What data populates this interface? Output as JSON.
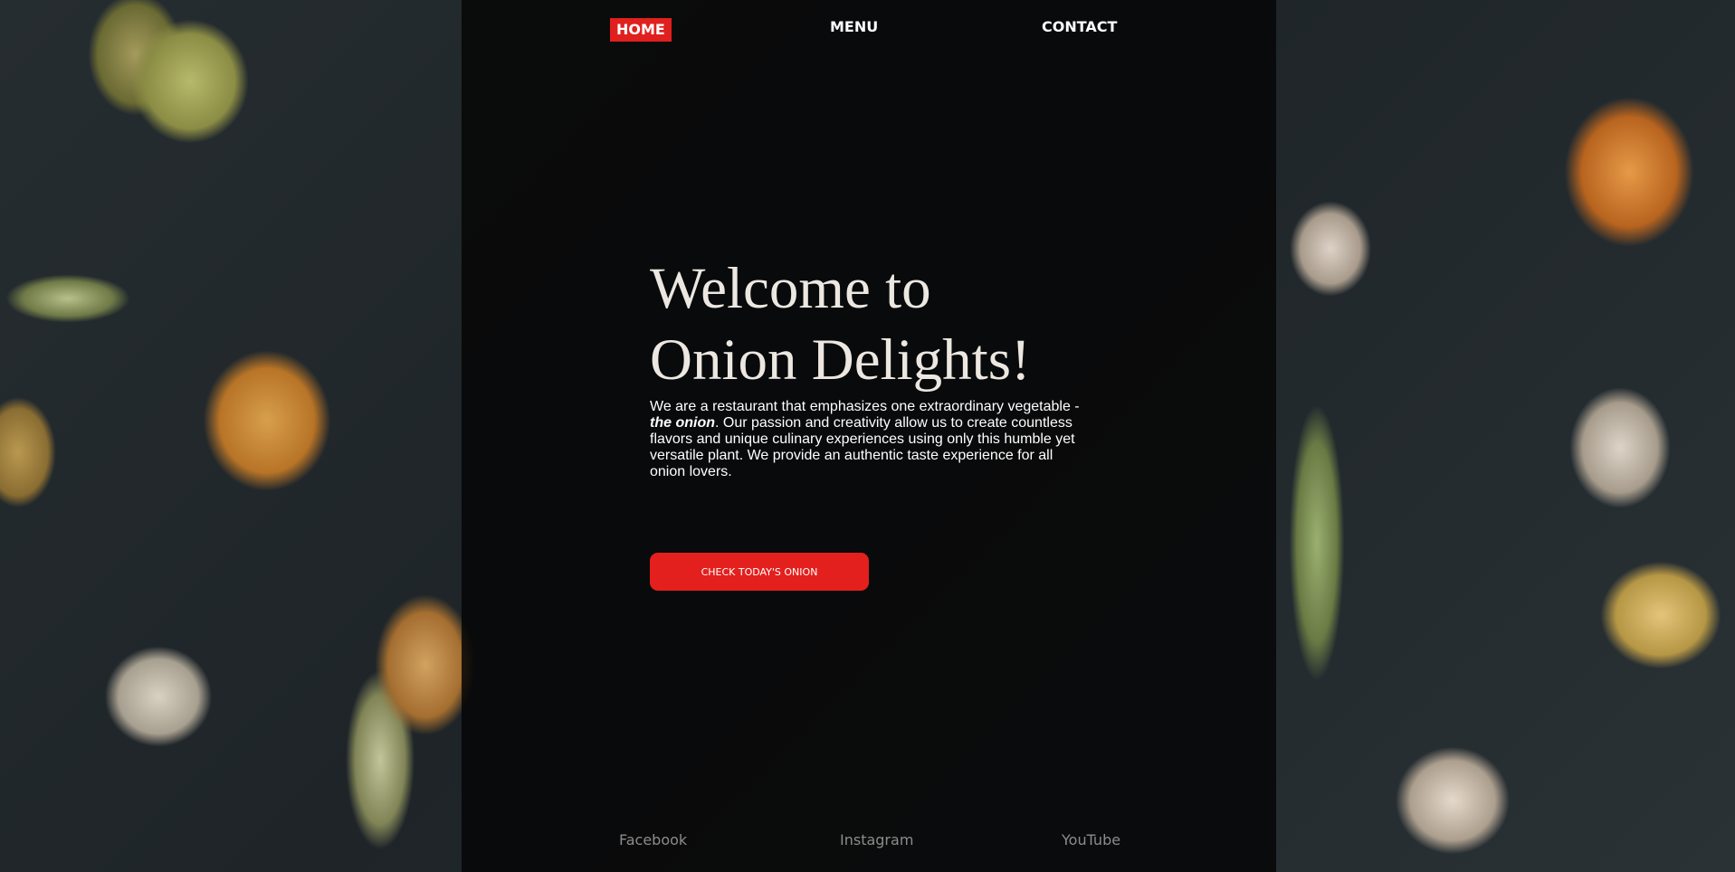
{
  "nav": {
    "home": "HOME",
    "menu": "MENU",
    "contact": "CONTACT"
  },
  "hero": {
    "title_line1": "Welcome to",
    "title_line2": "Onion Delights!",
    "text_before": "We are a restaurant that emphasizes one extraordinary vegetable - ",
    "text_emphasis": "the onion",
    "text_after": ". Our passion and creativity allow us to create countless flavors and unique culinary experiences using only this humble yet versatile plant. We provide an authentic taste experience for all onion lovers.",
    "cta_label": "CHECK TODAY'S ONION"
  },
  "social": {
    "facebook": "Facebook",
    "instagram": "Instagram",
    "youtube": "YouTube"
  },
  "colors": {
    "accent": "#e3201d",
    "overlay": "#060606",
    "title_text": "#ece7e1",
    "footer_link": "#8c8c8c"
  }
}
